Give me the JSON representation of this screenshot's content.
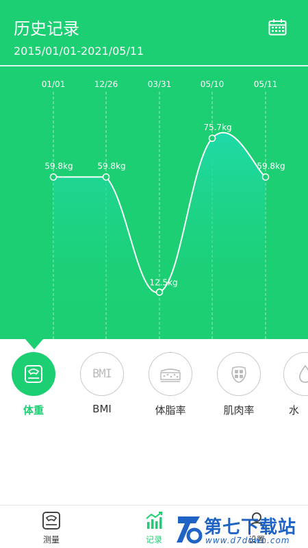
{
  "header": {
    "title": "历史记录",
    "date_range": "2015/01/01-2021/05/11",
    "calendar_icon": "calendar-icon"
  },
  "colors": {
    "primary": "#1ccf72",
    "fill_top": "#1fd9a5",
    "line": "#ffffff",
    "watermark": "#1f64c4"
  },
  "chart_data": {
    "type": "area",
    "categories": [
      "01/01",
      "12/26",
      "03/31",
      "05/10",
      "05/11"
    ],
    "values": [
      59.8,
      59.8,
      12.5,
      75.7,
      59.8
    ],
    "point_labels": [
      "59.8kg",
      "59.8kg",
      "12.5kg",
      "75.7kg",
      "59.8kg"
    ],
    "ylim": [
      0,
      90
    ],
    "grid": "vertical-dashed",
    "smooth": true
  },
  "metrics": [
    {
      "label": "体重",
      "icon": "scale-icon",
      "active": true
    },
    {
      "label": "BMI",
      "icon": "bmi-icon",
      "active": false
    },
    {
      "label": "体脂率",
      "icon": "body-fat-icon",
      "active": false
    },
    {
      "label": "肌肉率",
      "icon": "muscle-icon",
      "active": false
    },
    {
      "label": "水",
      "icon": "water-drop-icon",
      "active": false
    }
  ],
  "metric_icon_texts": {
    "bmi": "BMI"
  },
  "nav": [
    {
      "label": "测量",
      "icon": "scale-icon",
      "active": false
    },
    {
      "label": "记录",
      "icon": "chart-icon",
      "active": true
    },
    {
      "label": "设置",
      "icon": "user-icon",
      "active": false
    }
  ],
  "watermark": {
    "name": "第七下载站",
    "url": "www.d7down.com"
  }
}
